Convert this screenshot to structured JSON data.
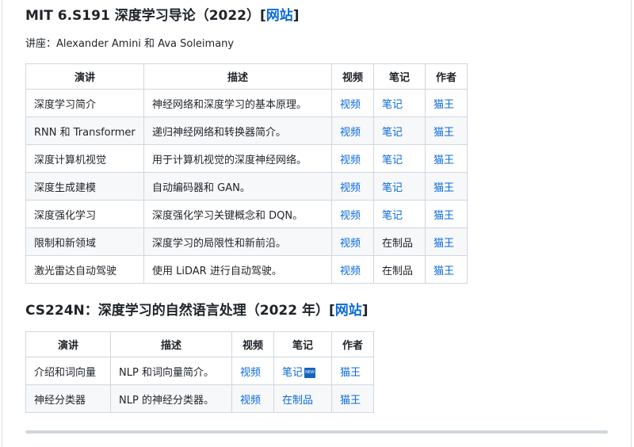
{
  "section1": {
    "title": "MIT 6.S191 深度学习导论（2022）",
    "bracket_open": "[",
    "link": "网站",
    "bracket_close": "]",
    "lecturer": "讲座：Alexander Amini 和 Ava Soleimany",
    "headers": [
      "演讲",
      "描述",
      "视频",
      "笔记",
      "作者"
    ],
    "rows": [
      {
        "topic": "深度学习简介",
        "desc": "神经网络和深度学习的基本原理。",
        "video": "视频",
        "notes": "笔记",
        "author": "猫王"
      },
      {
        "topic": "RNN 和 Transformer",
        "desc": "递归神经网络和转换器简介。",
        "video": "视频",
        "notes": "笔记",
        "author": "猫王"
      },
      {
        "topic": "深度计算机视觉",
        "desc": "用于计算机视觉的深度神经网络。",
        "video": "视频",
        "notes": "笔记",
        "author": "猫王"
      },
      {
        "topic": "深度生成建模",
        "desc": "自动编码器和 GAN。",
        "video": "视频",
        "notes": "笔记",
        "author": "猫王"
      },
      {
        "topic": "深度强化学习",
        "desc": "深度强化学习关键概念和 DQN。",
        "video": "视频",
        "notes": "笔记",
        "author": "猫王"
      },
      {
        "topic": "限制和新领域",
        "desc": "深度学习的局限性和新前沿。",
        "video": "视频",
        "notes": "在制品",
        "author": "猫王"
      },
      {
        "topic": "激光雷达自动驾驶",
        "desc": "使用 LiDAR 进行自动驾驶。",
        "video": "视频",
        "notes": "在制品",
        "author": "猫王"
      }
    ]
  },
  "section2": {
    "title": "CS224N：深度学习的自然语言处理（2022 年）",
    "bracket_open": "[",
    "link": "网站",
    "bracket_close": "]",
    "headers": [
      "演讲",
      "描述",
      "视频",
      "笔记",
      "作者"
    ],
    "rows": [
      {
        "topic": "介绍和词向量",
        "desc": "NLP 和词向量简介。",
        "video": "视频",
        "notes": "笔记",
        "author": "猫王",
        "badge": "NEW"
      },
      {
        "topic": "神经分类器",
        "desc": "NLP 的神经分类器。",
        "video": "视频",
        "notes": "在制品",
        "author": "猫王"
      }
    ]
  },
  "colors": {
    "link": "#0969da",
    "border": "#d0d7de",
    "stripe": "#f6f8fa",
    "badge": "#1565c0"
  },
  "icons": {
    "new_badge": "new-badge-icon"
  }
}
